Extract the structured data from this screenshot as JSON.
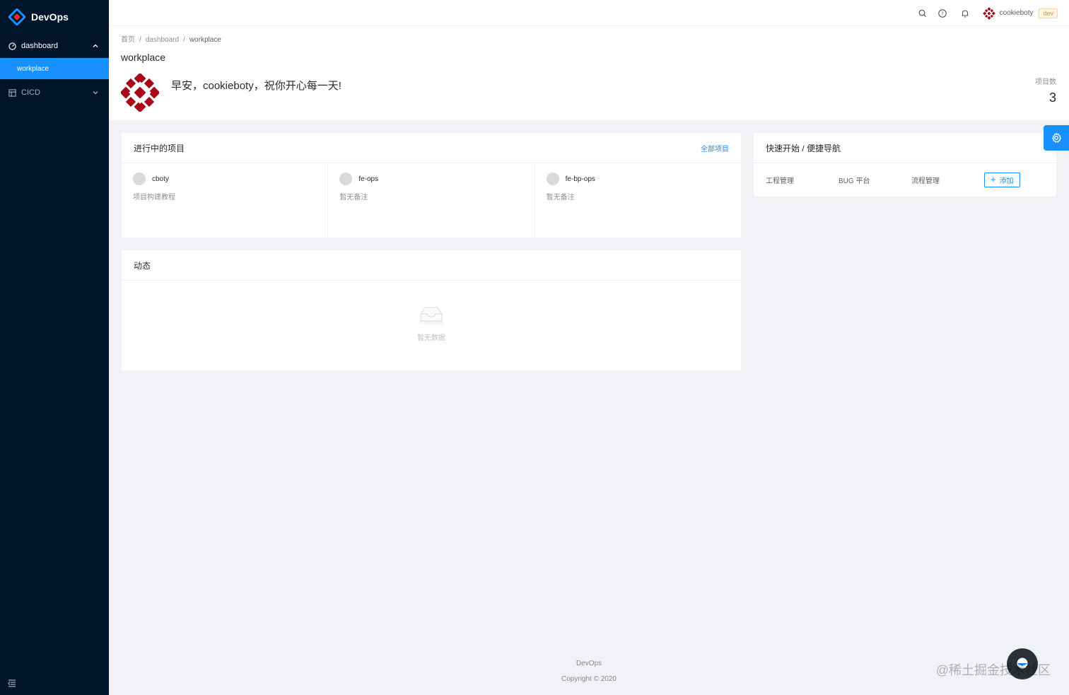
{
  "app": {
    "name": "DevOps"
  },
  "sidebar": {
    "groups": [
      {
        "label": "dashboard",
        "items": [
          {
            "label": "workplace",
            "active": true
          }
        ]
      },
      {
        "label": "CICD"
      }
    ]
  },
  "header": {
    "user": "cookieboty",
    "env_tag": "dev",
    "icons": [
      "search-icon",
      "question-icon",
      "bell-icon"
    ]
  },
  "breadcrumb": [
    "首页",
    "dashboard",
    "workplace"
  ],
  "page": {
    "title": "workplace",
    "greeting": "早安，cookieboty，祝你开心每一天!",
    "stat_label": "项目数",
    "stat_value": "3"
  },
  "projects_card": {
    "title": "进行中的项目",
    "extra": "全部项目",
    "items": [
      {
        "name": "cboty",
        "desc": "项目构建教程"
      },
      {
        "name": "fe-ops",
        "desc": "暂无备注"
      },
      {
        "name": "fe-bp-ops",
        "desc": "暂无备注"
      }
    ]
  },
  "activity_card": {
    "title": "动态",
    "empty_text": "暂无数据"
  },
  "quick_card": {
    "title": "快速开始 / 便捷导航",
    "links": [
      "工程管理",
      "BUG 平台",
      "流程管理"
    ],
    "add_label": "添加"
  },
  "footer": {
    "line1": "DevOps",
    "line2": "Copyright © 2020"
  },
  "watermark": "@稀土掘金技术社区",
  "colors": {
    "sider_bg": "#001529",
    "primary": "#1890ff",
    "env_tag": "#fa8c16"
  }
}
